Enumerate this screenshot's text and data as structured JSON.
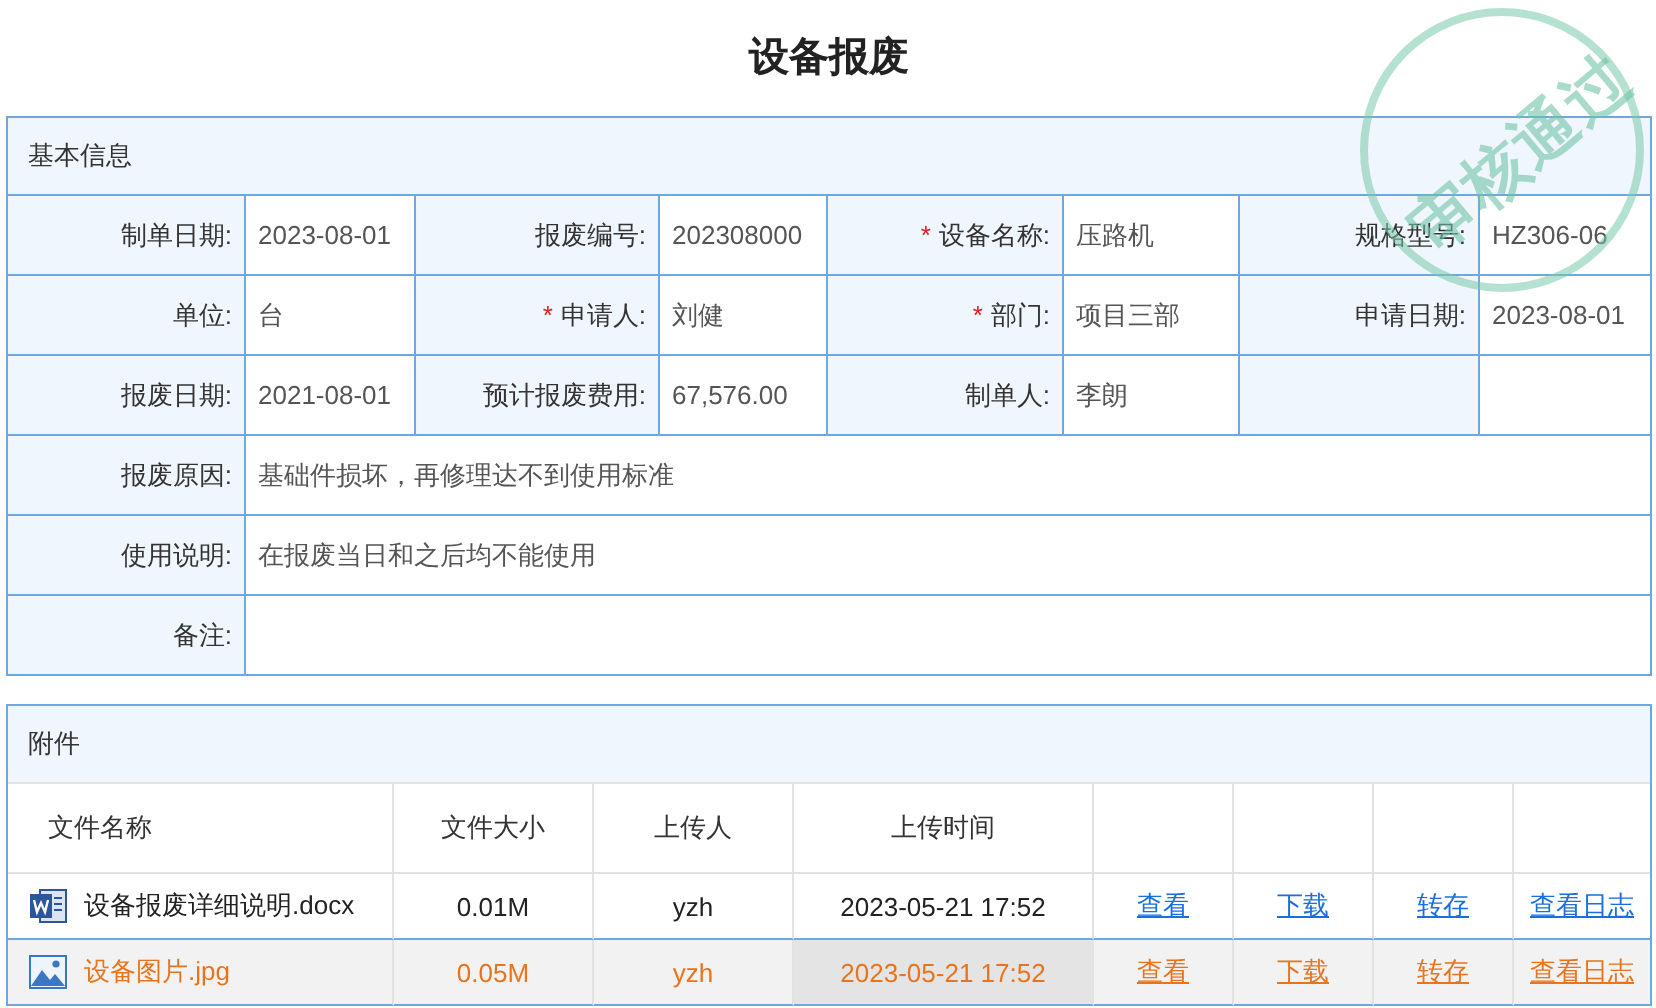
{
  "title": "设备报废",
  "stamp": {
    "text": "审核通过"
  },
  "basic_info": {
    "heading": "基本信息",
    "grid_rows": [
      [
        {
          "label": "制单日期:",
          "value": "2023-08-01"
        },
        {
          "label": "报废编号:",
          "value": "202308000"
        },
        {
          "required_mark": "*",
          "label": "设备名称:",
          "value": "压路机"
        },
        {
          "label": "规格型号:",
          "value": "HZ306-06"
        }
      ],
      [
        {
          "label": "单位:",
          "value": "台"
        },
        {
          "required_mark": "*",
          "label": "申请人:",
          "value": "刘健"
        },
        {
          "required_mark": "*",
          "label": "部门:",
          "value": "项目三部"
        },
        {
          "label": "申请日期:",
          "value": "2023-08-01"
        }
      ],
      [
        {
          "label": "报废日期:",
          "value": "2021-08-01"
        },
        {
          "label": "预计报废费用:",
          "value": "67,576.00"
        },
        {
          "label": "制单人:",
          "value": "李朗"
        }
      ]
    ],
    "wide_fields": [
      {
        "label": "报废原因:",
        "value": "基础件损坏，再修理达不到使用标准"
      },
      {
        "label": "使用说明:",
        "value": "在报废当日和之后均不能使用"
      },
      {
        "label": "备注:"
      }
    ]
  },
  "attachments": {
    "heading": "附件",
    "columns": [
      "文件名称",
      "文件大小",
      "上传人",
      "上传时间"
    ],
    "rows": [
      {
        "kind": "word",
        "name": "设备报废详细说明.docx",
        "size": "0.01M",
        "uploader": "yzh",
        "time": "2023-05-21 17:52",
        "actions": [
          "查看",
          "下载",
          "转存",
          "查看日志"
        ],
        "selected": false
      },
      {
        "kind": "image",
        "name": "设备图片.jpg",
        "size": "0.05M",
        "uploader": "yzh",
        "time": "2023-05-21 17:52",
        "actions": [
          "查看",
          "下载",
          "转存",
          "查看日志"
        ],
        "selected": true
      }
    ]
  }
}
